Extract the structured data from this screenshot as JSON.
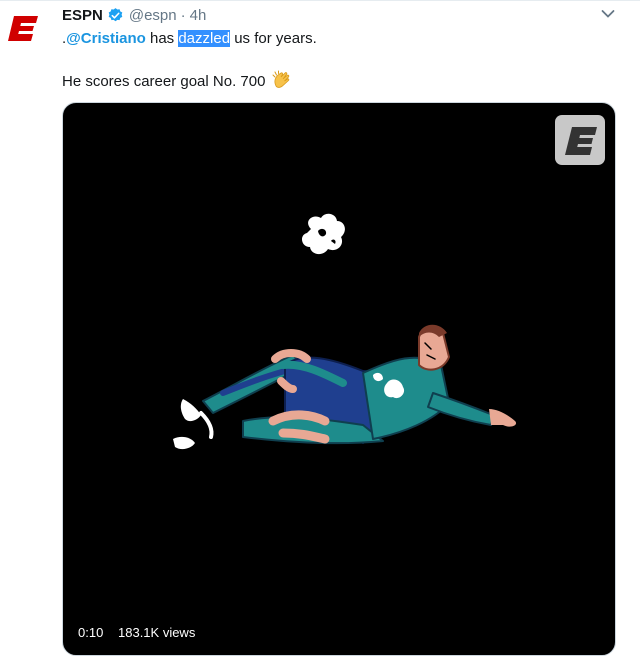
{
  "tweet": {
    "author_name": "ESPN",
    "author_handle": "@espn",
    "separator": "·",
    "time": "4h",
    "text_prefix": ".",
    "mention": "@Cristiano",
    "text_mid": " has ",
    "highlighted_word": "dazzled",
    "text_suffix": " us for years.",
    "line2": "He scores career goal No. 700",
    "emoji": "clapping-hands-icon"
  },
  "media": {
    "duration": "0:10",
    "views": "183.1K views"
  },
  "colors": {
    "brand_red": "#d00000",
    "verified_blue": "#1da1f2",
    "mention_blue": "#1b95e0",
    "highlight": "#3390ff",
    "teal": "#1e8c8c",
    "navy": "#1f3f8f",
    "skin": "#e8a894"
  }
}
